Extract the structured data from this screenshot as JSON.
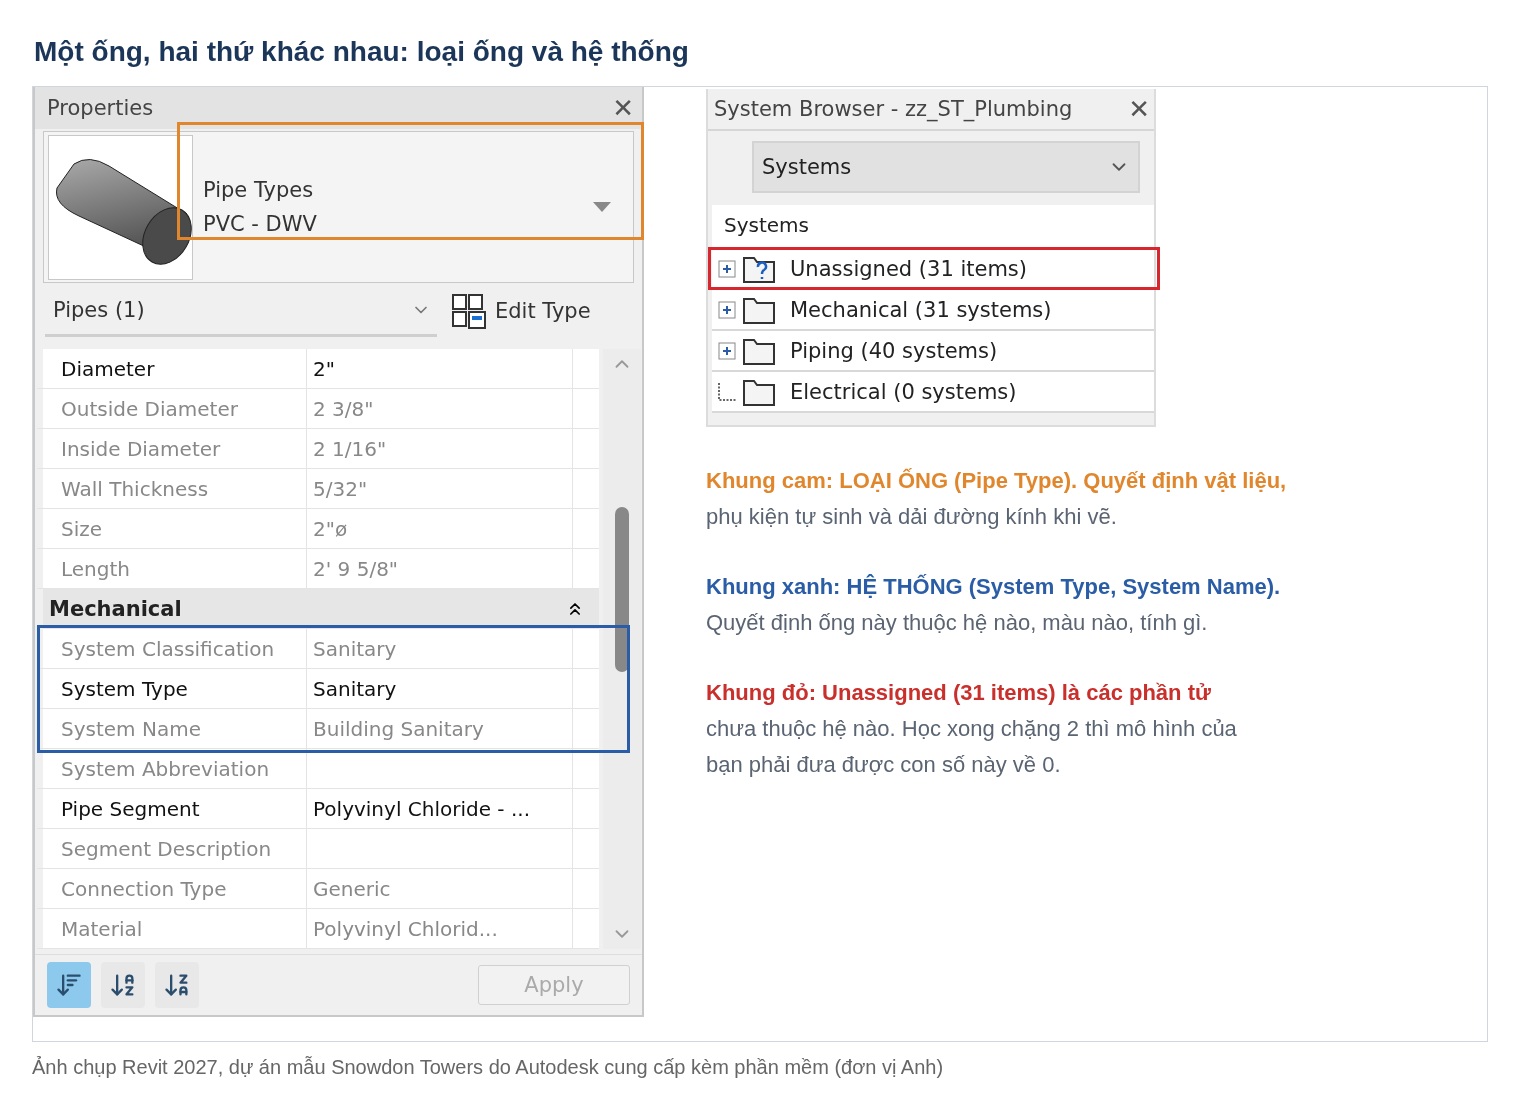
{
  "title": "Một ống, hai thứ khác nhau: loại ống và hệ thống",
  "properties": {
    "title": "Properties",
    "close": "✕",
    "type_selector": {
      "family": "Pipe Types",
      "type": "PVC - DWV",
      "framed": true
    },
    "instance": {
      "label": "Pipes (1)",
      "edit_type": "Edit Type"
    },
    "rows": [
      {
        "kind": "property",
        "label": "Diameter",
        "value": "2\"",
        "disabled": false,
        "framed": false
      },
      {
        "kind": "property",
        "label": "Outside Diameter",
        "value": "2 3/8\"",
        "disabled": true,
        "framed": false
      },
      {
        "kind": "property",
        "label": "Inside Diameter",
        "value": "2 1/16\"",
        "disabled": true,
        "framed": false
      },
      {
        "kind": "property",
        "label": "Wall Thickness",
        "value": "5/32\"",
        "disabled": true,
        "framed": false
      },
      {
        "kind": "property",
        "label": "Size",
        "value": "2\"ø",
        "disabled": true,
        "framed": false
      },
      {
        "kind": "property",
        "label": "Length",
        "value": "2'  9 5/8\"",
        "disabled": true,
        "framed": false
      },
      {
        "kind": "group",
        "label": "Mechanical",
        "expanded": true,
        "framed": false
      },
      {
        "kind": "property",
        "label": "System Classification",
        "value": "Sanitary",
        "disabled": true,
        "framed": true
      },
      {
        "kind": "property",
        "label": "System Type",
        "value": "Sanitary",
        "disabled": false,
        "framed": true
      },
      {
        "kind": "property",
        "label": "System Name",
        "value": "Building Sanitary",
        "disabled": true,
        "framed": true
      },
      {
        "kind": "property",
        "label": "System Abbreviation",
        "value": "",
        "disabled": true,
        "framed": false
      },
      {
        "kind": "property",
        "label": "Pipe Segment",
        "value": "Polyvinyl Chloride - ...",
        "disabled": false,
        "framed": false
      },
      {
        "kind": "property",
        "label": "Segment Description",
        "value": "",
        "disabled": true,
        "framed": false
      },
      {
        "kind": "property",
        "label": "Connection Type",
        "value": "Generic",
        "disabled": true,
        "framed": false
      },
      {
        "kind": "property",
        "label": "Material",
        "value": "Polyvinyl Chlorid...",
        "disabled": true,
        "framed": false
      }
    ],
    "sort_buttons": [
      {
        "kind": "grouped",
        "selected": true
      },
      {
        "kind": "ascending",
        "selected": false
      },
      {
        "kind": "descending",
        "selected": false
      }
    ],
    "apply": {
      "label": "Apply",
      "disabled": true
    }
  },
  "system_browser": {
    "title": "System Browser - zz_ST_Plumbing",
    "close": "✕",
    "view": "Systems",
    "tree": {
      "label": "Systems",
      "children": [
        {
          "kind": "unassigned",
          "label": "Unassigned (31 items)",
          "expandable": true,
          "framed": true
        },
        {
          "kind": "folder",
          "label": "Mechanical (31 systems)",
          "expandable": true,
          "framed": false
        },
        {
          "kind": "folder",
          "label": "Piping (40 systems)",
          "expandable": true,
          "framed": false
        },
        {
          "kind": "folder",
          "label": "Electrical (0 systems)",
          "expandable": false,
          "framed": false
        }
      ]
    }
  },
  "notes": [
    {
      "lead": "Khung cam: LOẠI ỐNG (Pipe Type). Quyết định vật liệu,",
      "text": "phụ kiện tự sinh và dải đường kính khi vẽ.",
      "color": "#e0872e"
    },
    {
      "lead": "Khung xanh: HỆ THỐNG (System Type, System Name).",
      "text": "Quyết định ống này thuộc hệ nào, màu nào, tính gì.",
      "color": "#2a5da6"
    },
    {
      "lead": "Khung đỏ: Unassigned (31 items) là các phần tử",
      "text": "chưa thuộc hệ nào. Học xong chặng 2 thì mô hình của bạn phải đưa được con số này về 0.",
      "color": "#c9302c"
    }
  ],
  "caption": "Ảnh chụp Revit 2027, dự án mẫu Snowdon Towers do Autodesk cung cấp kèm phần mềm (đơn vị Anh)"
}
